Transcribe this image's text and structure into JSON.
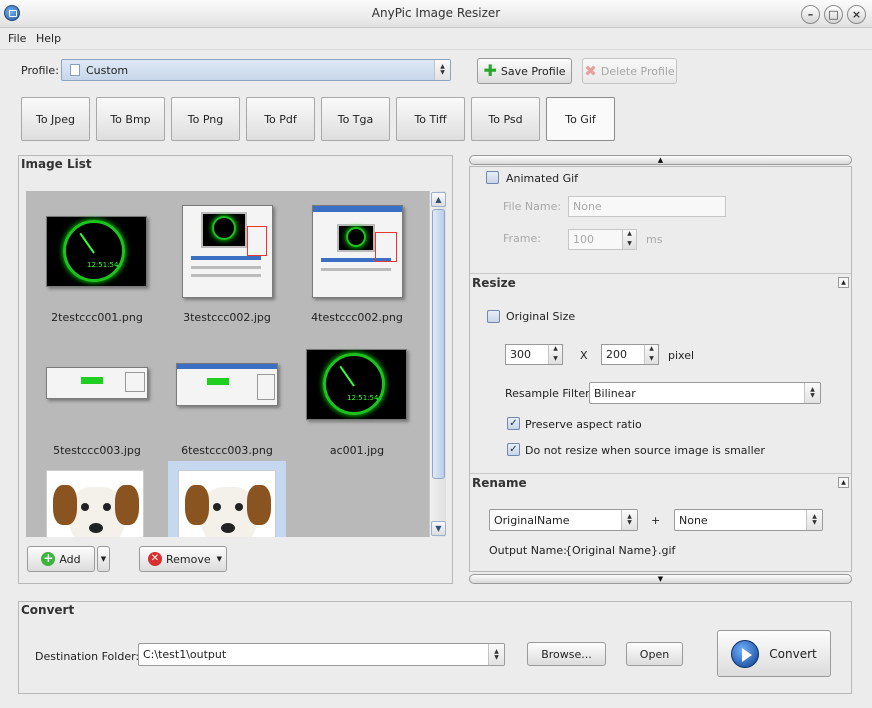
{
  "window": {
    "title": "AnyPic Image Resizer"
  },
  "menu": {
    "file": "File",
    "help": "Help"
  },
  "profile": {
    "label": "Profile:",
    "value": "Custom",
    "save_label": "Save Profile",
    "delete_label": "Delete Profile"
  },
  "formats": [
    {
      "label": "To Jpeg"
    },
    {
      "label": "To Bmp"
    },
    {
      "label": "To Png"
    },
    {
      "label": "To Pdf"
    },
    {
      "label": "To Tga"
    },
    {
      "label": "To Tiff"
    },
    {
      "label": "To Psd"
    },
    {
      "label": "To Gif"
    }
  ],
  "active_format": "To Gif",
  "image_list": {
    "title": "Image List",
    "items": [
      {
        "name": "2testccc001.png"
      },
      {
        "name": "3testccc002.jpg"
      },
      {
        "name": "4testccc002.png"
      },
      {
        "name": "5testccc003.jpg"
      },
      {
        "name": "6testccc003.png"
      },
      {
        "name": "ac001.jpg"
      }
    ],
    "add_label": "Add",
    "remove_label": "Remove"
  },
  "gif": {
    "animated_label": "Animated Gif",
    "file_name_label": "File Name:",
    "file_name_value": "None",
    "frame_label": "Frame:",
    "frame_value": "100",
    "frame_unit": "ms"
  },
  "resize": {
    "title": "Resize",
    "original_size_label": "Original Size",
    "width": "300",
    "x_label": "X",
    "height": "200",
    "unit": "pixel",
    "filter_label": "Resample Filter:",
    "filter_value": "Bilinear",
    "preserve_label": "Preserve aspect ratio",
    "preserve_checked": true,
    "no_resize_label": "Do not resize when source image is smaller",
    "no_resize_checked": true
  },
  "rename": {
    "title": "Rename",
    "left_value": "OriginalName",
    "plus": "+",
    "right_value": "None",
    "output_label": "Output Name:",
    "output_value": "{Original Name}.gif"
  },
  "convert": {
    "title": "Convert",
    "dest_label": "Destination Folder:",
    "dest_value": "C:\\test1\\output",
    "browse_label": "Browse...",
    "open_label": "Open",
    "convert_label": "Convert"
  }
}
